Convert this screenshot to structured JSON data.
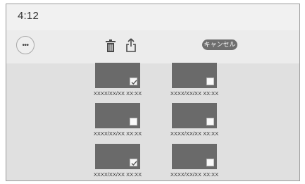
{
  "status": {
    "time": "4:12"
  },
  "toolbar": {
    "more_label": "•••",
    "delete_icon": "trash-icon",
    "share_icon": "share-icon",
    "cancel_label": "キャンセル"
  },
  "photos": [
    {
      "caption": "XXXX/XX/XX XX:XX",
      "checked": true
    },
    {
      "caption": "XXXX/XX/XX XX:XX",
      "checked": false
    },
    {
      "caption": "XXXX/XX/XX XX:XX",
      "checked": false
    },
    {
      "caption": "XXXX/XX/XX XX:XX",
      "checked": false
    },
    {
      "caption": "XXXX/XX/XX XX:XX",
      "checked": true
    },
    {
      "caption": "XXXX/XX/XX XX:XX",
      "checked": false
    }
  ]
}
